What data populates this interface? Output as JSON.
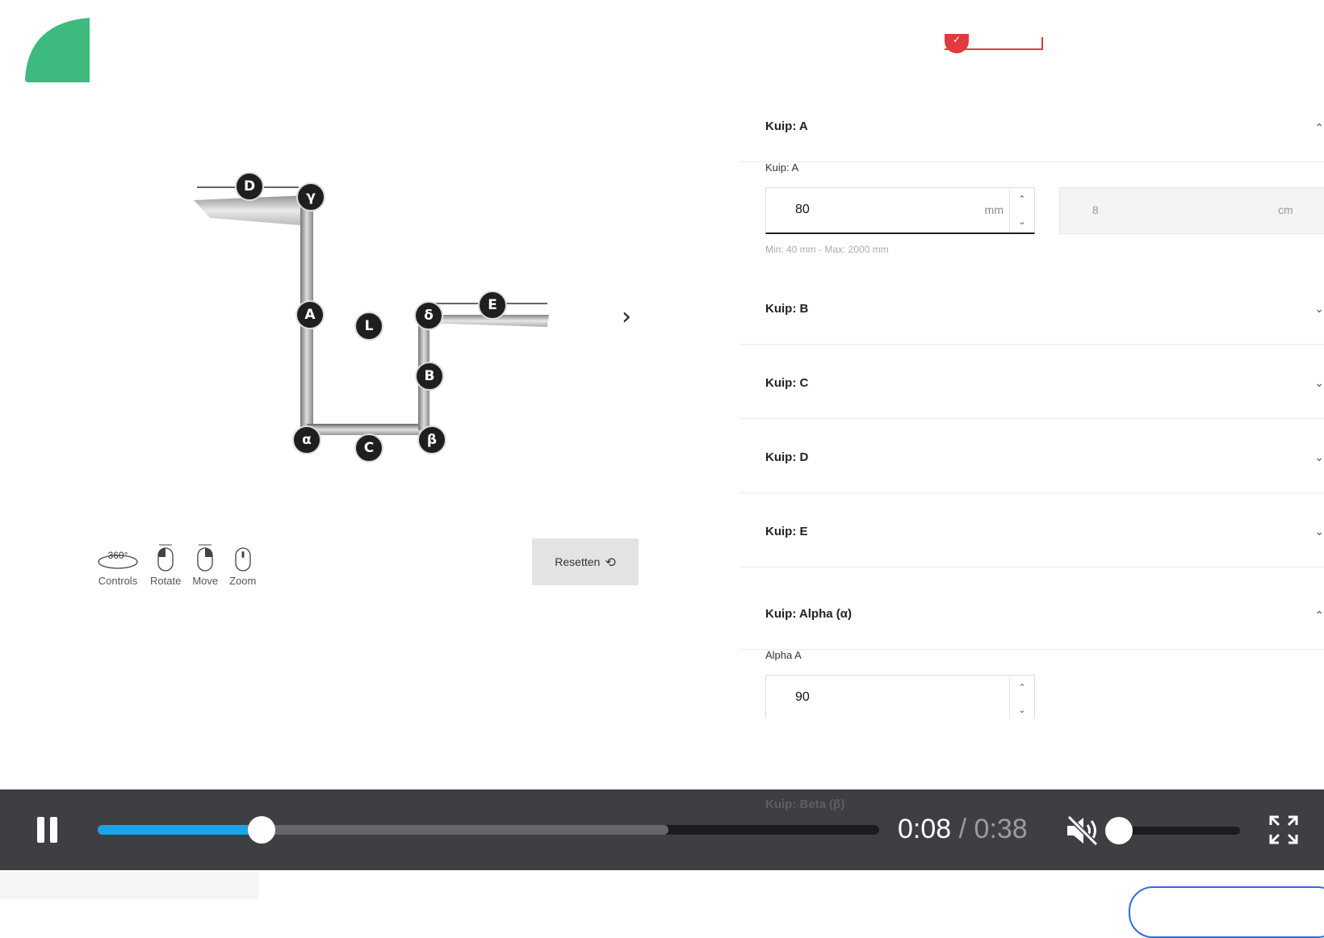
{
  "viewer": {
    "labels": {
      "D": "D",
      "gamma": "γ",
      "A": "A",
      "L": "L",
      "delta": "δ",
      "E": "E",
      "B": "B",
      "alpha": "α",
      "C": "C",
      "beta": "β"
    },
    "controls": [
      {
        "icon": "360-controls-icon",
        "icon_text": "360°",
        "label": "Controls"
      },
      {
        "icon": "mouse-rotate-icon",
        "label": "Rotate"
      },
      {
        "icon": "mouse-move-icon",
        "label": "Move"
      },
      {
        "icon": "mouse-zoom-icon",
        "label": "Zoom"
      }
    ],
    "reset_label": "Resetten"
  },
  "panel": {
    "sections": [
      {
        "title": "Kuip: A",
        "expanded": true
      },
      {
        "title": "Kuip: B",
        "expanded": false
      },
      {
        "title": "Kuip: C",
        "expanded": false
      },
      {
        "title": "Kuip: D",
        "expanded": false
      },
      {
        "title": "Kuip: E",
        "expanded": false
      },
      {
        "title": "Kuip: Alpha (α)",
        "expanded": true
      }
    ],
    "kuip_a": {
      "field_label": "Kuip: A",
      "value": "80",
      "unit": "mm",
      "cm_value": "8",
      "cm_unit": "cm",
      "hint": "Min: 40 mm - Max: 2000 mm"
    },
    "alpha": {
      "field_label": "Alpha A",
      "value": "90"
    },
    "hidden_next": "Kuip: Beta (β)"
  },
  "video": {
    "current_time": "0:08",
    "separator": " / ",
    "total_time": "0:38",
    "progress": 0.21,
    "buffered": 0.73,
    "volume": 0.0,
    "muted": true,
    "accent_color": "#18a6e6"
  },
  "colors": {
    "logo": "#3dba7d",
    "step_marker": "#e03a3e"
  }
}
